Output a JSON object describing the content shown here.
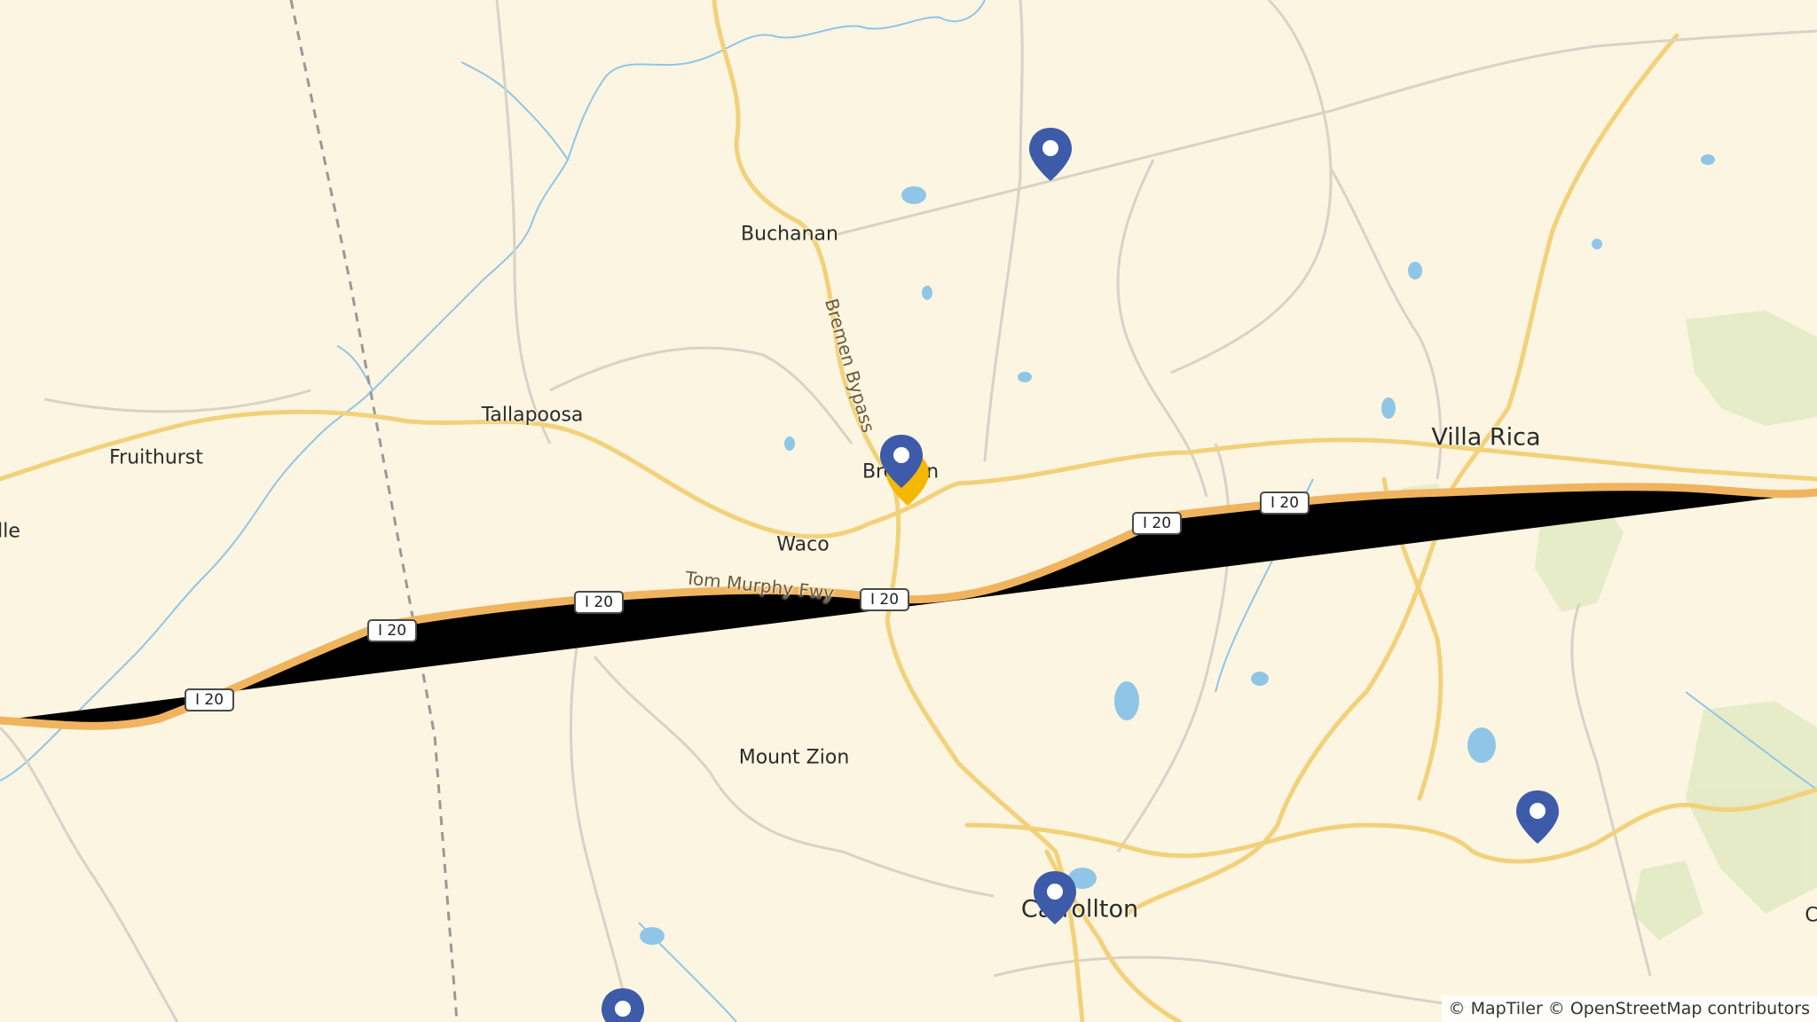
{
  "map": {
    "places": {
      "buchanan": "Buchanan",
      "tallapoosa": "Tallapoosa",
      "fruithurst": "Fruithurst",
      "bremen": "Bremen",
      "waco": "Waco",
      "villa_rica": "Villa Rica",
      "mount_zion": "Mount Zion",
      "carrollton": "Carrollton",
      "edge_left": "lle",
      "edge_right": "C"
    },
    "roads": {
      "i20_label": "I 20",
      "tom_murphy": "Tom Murphy Fwy",
      "bremen_bypass": "Bremen Bypass"
    },
    "markers": [
      {
        "name": "Marker near Buchanan",
        "color": "#3d5ba9"
      },
      {
        "name": "Marker Bremen",
        "color": "#3d5ba9"
      },
      {
        "name": "Marker Carrollton",
        "color": "#3d5ba9"
      },
      {
        "name": "Marker east of Carrollton",
        "color": "#3d5ba9"
      },
      {
        "name": "Marker south",
        "color": "#3d5ba9"
      }
    ],
    "highlight_marker_color": "#f5b800",
    "attribution": "© MapTiler © OpenStreetMap contributors"
  }
}
